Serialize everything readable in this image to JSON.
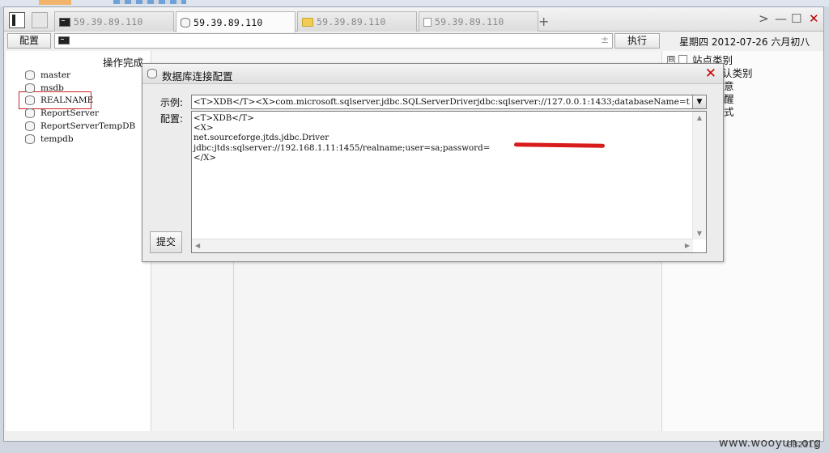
{
  "tabs": [
    {
      "label": "59.39.89.110",
      "icon": "terminal-icon",
      "active": false
    },
    {
      "label": "59.39.89.110",
      "icon": "database-icon",
      "active": true
    },
    {
      "label": "59.39.89.110",
      "icon": "folder-icon",
      "active": false
    },
    {
      "label": "59.39.89.110",
      "icon": "file-icon",
      "active": false
    }
  ],
  "tabbar": {
    "add": "+",
    "nav_next": ">",
    "minimize": "—",
    "maximize": "☐",
    "close": "✕"
  },
  "toolbar": {
    "config_label": "配置",
    "command_value": "",
    "adjust": "±",
    "execute_label": "执行"
  },
  "date": "星期四 2012-07-26 六月初八",
  "left_pane": {
    "status": "操作完成",
    "databases": [
      "master",
      "msdb",
      "REALNAME",
      "ReportServer",
      "ReportServerTempDB",
      "tempdb"
    ],
    "highlighted": "REALNAME"
  },
  "right_pane": {
    "tree": [
      {
        "expander": "⊟",
        "label": "站点类别"
      },
      {
        "label": "认类别"
      },
      {
        "label": "意"
      },
      {
        "label": "醒"
      },
      {
        "label": "式"
      }
    ]
  },
  "dialog": {
    "title": "数据库连接配置",
    "close": "✕",
    "example_label": "示例:",
    "example_value": "<T>XDB</T><X>com.microsoft.sqlserver.jdbc.SQLServerDriverjdbc:sqlserver://127.0.0.1:1433;databaseName=t",
    "config_label": "配置:",
    "config_lines": [
      "<T>XDB</T>",
      "<X>",
      "net.sourceforge.jtds.jdbc.Driver",
      "jdbc:jtds:sqlserver://192.168.1.11:1455/realname;user=sa;password=",
      "</X>"
    ],
    "submit_label": "提交"
  },
  "footer_code": "GB2312",
  "watermark": "www.wooyun.org",
  "colors": {
    "accent_red": "#d02020",
    "window_bg": "#f0f0f0",
    "folder_yellow": "#f2cd55"
  }
}
